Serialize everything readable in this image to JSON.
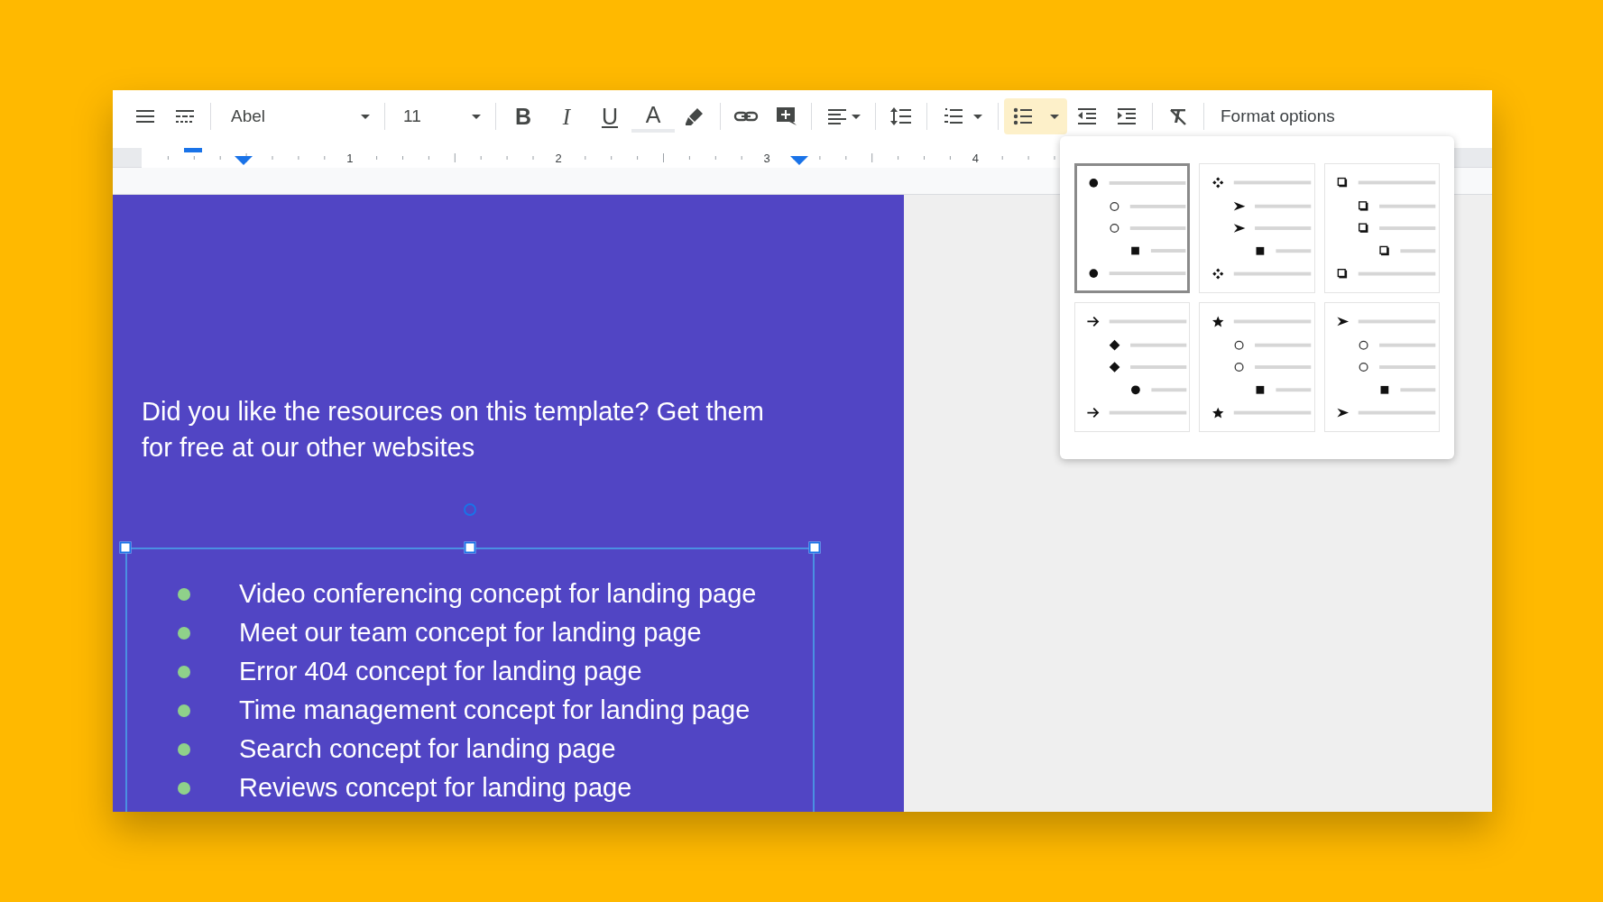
{
  "toolbar": {
    "font_family": {
      "value": "Abel"
    },
    "font_size": {
      "value": "11"
    },
    "format_buttons": [
      {
        "label": "B",
        "kind": "bold"
      },
      {
        "label": "I",
        "kind": "italic"
      },
      {
        "label": "U",
        "kind": "underline"
      },
      {
        "label": "A",
        "kind": "text_color"
      }
    ],
    "bulleted_list": {
      "selected": true
    },
    "format_options": {
      "label": "Format options"
    }
  },
  "ruler": {
    "labels": [
      "1",
      "2",
      "3",
      "4"
    ]
  },
  "slide": {
    "heading": "Did you like the resources on this template? Get them for free at our other websites",
    "text_box": {
      "selected": true,
      "items": [
        "Video conferencing concept for landing page",
        "Meet our team concept for landing page",
        "Error 404 concept for landing page",
        "Time management concept for landing page",
        "Search concept for landing page",
        "Reviews concept for landing page"
      ]
    }
  },
  "bullet_menu": {
    "presets": [
      {
        "selected": true
      },
      {
        "selected": false
      },
      {
        "selected": false
      },
      {
        "selected": false
      },
      {
        "selected": false
      },
      {
        "selected": false
      }
    ]
  }
}
